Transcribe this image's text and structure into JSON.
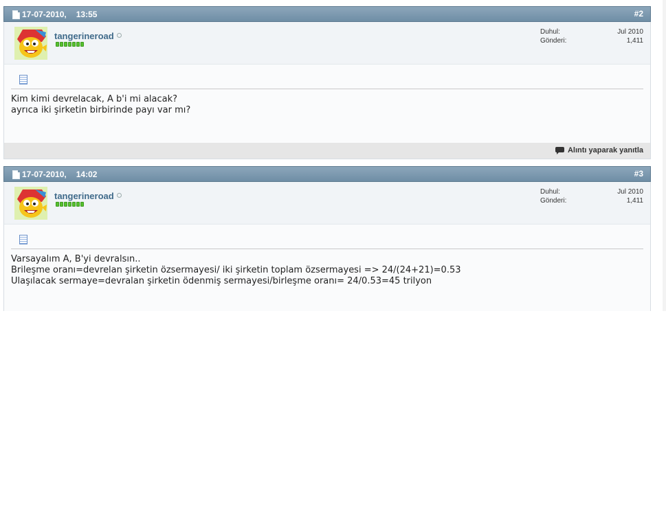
{
  "posts": [
    {
      "date": "17-07-2010,",
      "time": "13:55",
      "number": "#2",
      "username": "tangerineroad",
      "stats": [
        {
          "label": "Duhul:",
          "value": "Jul 2010"
        },
        {
          "label": "Gönderi:",
          "value": "1,411"
        }
      ],
      "content": "Kim kimi devrelacak, A b'i mi alacak?\nayrıca iki şirketin birbirinde payı var mı?",
      "quote_label": "Alıntı yaparak yanıtla"
    },
    {
      "date": "17-07-2010,",
      "time": "14:02",
      "number": "#3",
      "username": "tangerineroad",
      "stats": [
        {
          "label": "Duhul:",
          "value": "Jul 2010"
        },
        {
          "label": "Gönderi:",
          "value": "1,411"
        }
      ],
      "content": "Varsayalım A, B'yi devralsın..\nBrileşme oranı=devrelan şirketin özsermayesi/ iki şirketin toplam özsermayesi => 24/(24+21)=0.53\nUlaşılacak sermaye=devralan şirketin ödenmiş sermayesi/birleşme oranı= 24/0.53=45 trilyon"
    }
  ],
  "colors": {
    "header": "#7b97ad",
    "username": "#3f6a8a",
    "reputation": "#58c02f"
  },
  "icons": [
    "post-doc-icon",
    "online-status-icon",
    "message-icon",
    "quote-icon"
  ]
}
